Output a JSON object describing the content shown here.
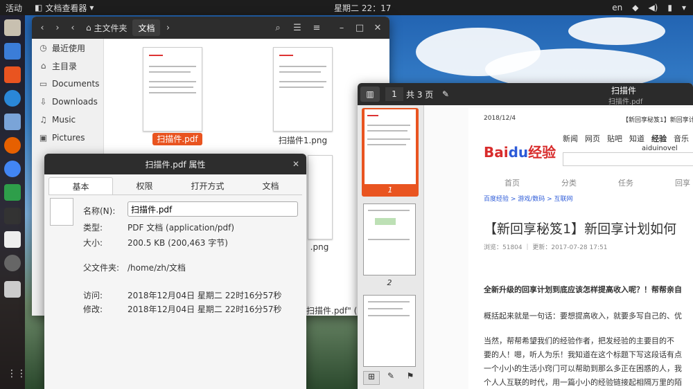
{
  "topbar": {
    "activities": "活动",
    "app_name": "文档查看器",
    "clock": "星期二 22：17",
    "lang": "en"
  },
  "files": {
    "location": "主文件夹",
    "current": "文档",
    "sidebar": [
      {
        "label": "最近使用",
        "icon": "clock-icon"
      },
      {
        "label": "主目录",
        "icon": "home-icon"
      },
      {
        "label": "Documents",
        "icon": "folder-icon"
      },
      {
        "label": "Downloads",
        "icon": "download-icon"
      },
      {
        "label": "Music",
        "icon": "music-icon"
      },
      {
        "label": "Pictures",
        "icon": "pictures-icon"
      }
    ],
    "items": [
      "扫描件.pdf",
      "扫描件1.png",
      ".png"
    ],
    "statusbar": "扫描件.pdf\" (20"
  },
  "props": {
    "title": "扫描件.pdf 属性",
    "tabs": [
      "基本",
      "权限",
      "打开方式",
      "文档"
    ],
    "labels": {
      "name": "名称(N):",
      "type": "类型:",
      "size": "大小:",
      "parent": "父文件夹:",
      "accessed": "访问:",
      "modified": "修改:"
    },
    "values": {
      "name": "扫描件.pdf",
      "type": "PDF 文档 (application/pdf)",
      "size": "200.5 KB (200,463 字节)",
      "parent": "/home/zh/文档",
      "accessed": "2018年12月04日 星期二 22时16分57秒",
      "modified": "2018年12月04日 星期二 22时16分57秒"
    }
  },
  "viewer": {
    "page_input": "1",
    "page_total": "共 3 页",
    "title": "扫描件",
    "subtitle": "扫描件.pdf",
    "thumb_labels": [
      "1",
      "2"
    ],
    "doc": {
      "date": "2018/12/4",
      "header_right": "【新回享秘笈1】新回享计划如何",
      "nav": [
        "新闻",
        "网页",
        "贴吧",
        "知道",
        "经验",
        "音乐"
      ],
      "site": "aiduinovel",
      "menu": [
        "首页",
        "分类",
        "任务",
        "回享"
      ],
      "breadcrumb": "百度经验 > 游戏/数码 > 互联网",
      "heading": "【新回享秘笈1】新回享计划如何",
      "meta": "浏览：51804 ｜ 更新：2017-07-28 17:51",
      "bold_line": "全新升级的回享计划到底应该怎样提高收入呢？！帮帮亲自",
      "p1": "概括起来就是一句话：要想提高收入，就要多写自己的、优",
      "p2": "当然，帮帮希望我们的经验作者，把发经验的主要目的不",
      "p3": "要的人！嗯，听人为乐！我知道在这个标题下写这段话有点",
      "p4": "一个小小的生活小窍门可以帮助到那么多正在困惑的人，我",
      "p5": "个人人互联的时代，用一篇小小的经验链接起相隔万里的陌"
    }
  }
}
